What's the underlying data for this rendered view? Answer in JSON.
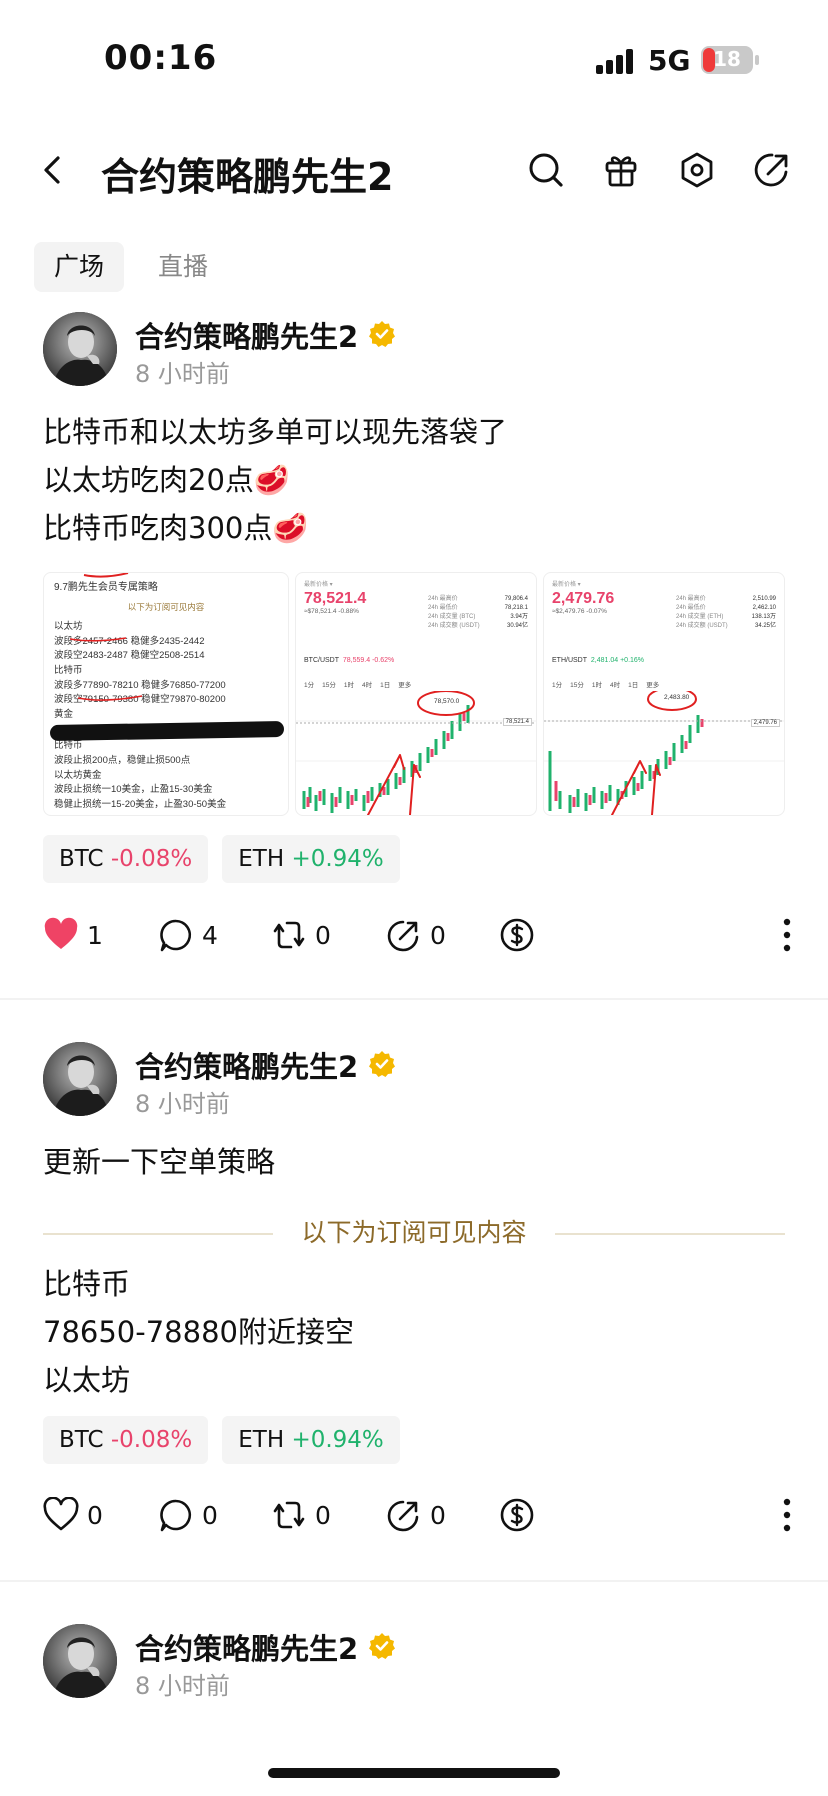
{
  "status_bar": {
    "time": "00:16",
    "network": "5G",
    "battery": "18"
  },
  "header": {
    "title": "合约策略鹏先生2"
  },
  "tabs": [
    {
      "label": "广场",
      "active": true
    },
    {
      "label": "直播",
      "active": false
    }
  ],
  "posts": [
    {
      "author": "合约策略鹏先生2",
      "time": "8 小时前",
      "lines": [
        "比特币和以太坊多单可以现先落袋了",
        "以太坊吃肉20点🥩",
        "比特币吃肉300点🥩"
      ],
      "images": {
        "strategy": {
          "title": "9.7鹏先生会员专属策略",
          "subtitle": "以下为订阅可见内容",
          "lines": [
            "以太坊",
            "波段多2457-2466 稳健多2435-2442",
            "波段空2483-2487 稳健空2508-2514",
            "比特币",
            "波段多77890-78210 稳健多76850-77200",
            "波段空79150-79380 稳健空79870-80200",
            "黄金",
            "比特币",
            "波段止损200点，稳健止损500点",
            "以太坊黄金",
            "波段止损统一10美金，止盈15-30美金",
            "稳健止损统一15-20美金，止盈30-50美金"
          ]
        },
        "btc_chart": {
          "price": "78,521.4",
          "sub": "≈$78,521.4 -0.88%",
          "pair": "BTC/USDT",
          "pair_price": "78,559.4 -0.62%",
          "stats": [
            "79,806.4",
            "78,218.1",
            "3.94万",
            "30.94亿"
          ],
          "annotation": "78,570.0",
          "tag": "78,521.4",
          "intervals": [
            "1分",
            "15分",
            "1时",
            "4时",
            "1日",
            "更多"
          ]
        },
        "eth_chart": {
          "price": "2,479.76",
          "sub": "≈$2,479.76 -0.07%",
          "pair": "ETH/USDT",
          "pair_price": "2,481.04 +0.16%",
          "stats": [
            "2,510.99",
            "2,462.10",
            "138.13万",
            "34.25亿"
          ],
          "annotation": "2,483.80",
          "tag": "2,479.76",
          "intervals": [
            "1分",
            "15分",
            "1时",
            "4时",
            "1日",
            "更多"
          ]
        }
      },
      "chips": [
        {
          "symbol": "BTC",
          "change": "-0.08%"
        },
        {
          "symbol": "ETH",
          "change": "+0.94%"
        }
      ],
      "likes": "1",
      "comments": "4",
      "reposts": "0",
      "shares": "0"
    },
    {
      "author": "合约策略鹏先生2",
      "time": "8 小时前",
      "lines": [
        "更新一下空单策略"
      ],
      "subscriber_divider": "以下为订阅可见内容",
      "body_lines": [
        "比特币",
        "78650-78880附近接空",
        "以太坊"
      ],
      "chips": [
        {
          "symbol": "BTC",
          "change": "-0.08%"
        },
        {
          "symbol": "ETH",
          "change": "+0.94%"
        }
      ],
      "likes": "0",
      "comments": "0",
      "reposts": "0",
      "shares": "0"
    },
    {
      "author": "合约策略鹏先生2",
      "time": "8 小时前"
    }
  ],
  "colors": {
    "negative": "#e8436b",
    "positive": "#20b26c",
    "like": "#ef4365",
    "gold": "#8c6a2a",
    "verified": "#f5b800"
  },
  "icons": [
    "back-icon",
    "search-icon",
    "gift-icon",
    "settings-hex-icon",
    "share-icon",
    "heart-icon",
    "comment-icon",
    "repost-icon",
    "share-arrow-icon",
    "tip-dollar-icon",
    "more-vertical-icon",
    "verified-icon"
  ]
}
